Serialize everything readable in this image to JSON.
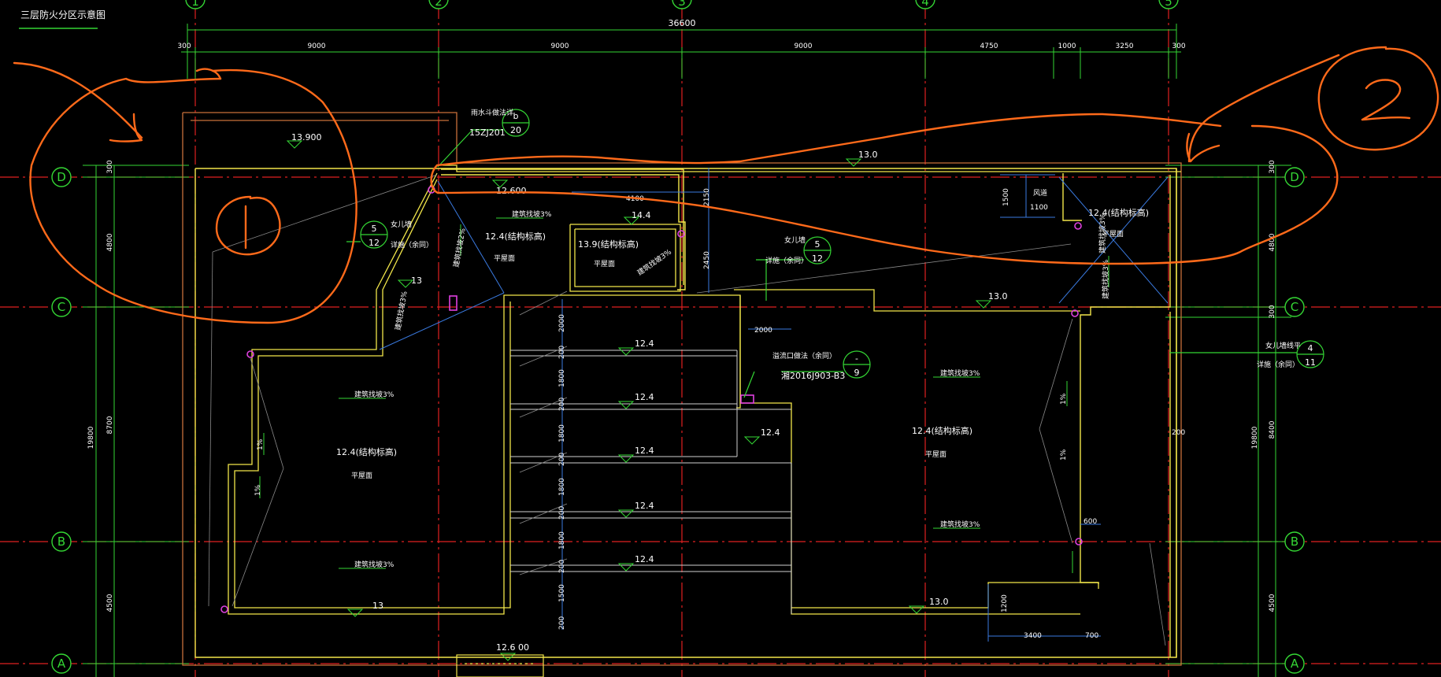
{
  "drawing_title": "三层防火分区示意图",
  "colors": {
    "background": "#000000",
    "grid_axis": "#e02020",
    "dimension": "#34d634",
    "wall": "#f2e64a",
    "parapet": "#e8853a",
    "slope": "#34d634",
    "annotation": "#ff6a1a",
    "pipe": "#e040e0",
    "thin": "#b0b0b0",
    "blue": "#3a7ae0"
  },
  "grid_columns": [
    "1",
    "2",
    "3",
    "4",
    "5"
  ],
  "grid_rows": [
    "D",
    "C",
    "B",
    "A"
  ],
  "overall_width": "36600",
  "column_spacings": [
    "300",
    "9000",
    "9000",
    "9000",
    "4750",
    "1000",
    "3250",
    "300"
  ],
  "left_row_dims": [
    "300",
    "4800",
    "8700",
    "4500"
  ],
  "left_total": "19800",
  "right_row_dims": [
    "300",
    "4800",
    "300",
    "8400",
    "4500"
  ],
  "right_total": "19800",
  "elevations": [
    "13.900",
    "12.600",
    "14.4",
    "13.0",
    "13.0",
    "13",
    "13",
    "13.0",
    "12.4",
    "12.4",
    "12.4",
    "12.4",
    "12.4",
    "12.4",
    "12.6 00"
  ],
  "roof_labels": {
    "structural_left_a": "12.4(结构标高)",
    "structural_left_b": "12.4(结构标高)",
    "structural_mid": "13.9(结构标高)",
    "structural_right_a": "12.4(结构标高)",
    "structural_right_b": "12.4(结构标高)",
    "roof_plane": "平屋面"
  },
  "slope_labels": {
    "two_pct": "建筑找坡2%",
    "three_pct": "建筑找坡3%",
    "one_pct": "1%"
  },
  "details": {
    "rain_outlet": "雨水斗做法详",
    "rain_outlet_atlas": "15ZJ201",
    "rain_outlet_ref_top": "b",
    "rain_outlet_ref_bottom": "20",
    "parapet": "女儿墙",
    "parapet_detail": "详施（余同）",
    "parapet_ref_top": "5",
    "parapet_ref_bottom": "12",
    "parapet_ref2_top": "4",
    "parapet_ref2_bottom": "11",
    "parapet_line": "女儿墙线平",
    "overflow": "溢流口做法（余同）",
    "overflow_atlas": "湘2016J903-B3",
    "overflow_ref_top": "-",
    "overflow_ref_bottom": "9",
    "shaft": "风道"
  },
  "inner_dims": {
    "d_4100": "4100",
    "d_2150": "2150",
    "d_2450": "2450",
    "d_1500": "1500",
    "d_1100": "1100",
    "d_2000": "2000",
    "d_stair_2000": "2000",
    "d_200": "200",
    "d_1800": "1800",
    "d_1500b": "1500",
    "d_200r": "200",
    "d_600": "600",
    "d_1200": "1200",
    "d_3400": "3400",
    "d_700": "700"
  },
  "annotations": {
    "circle_one": "1",
    "circle_two": "2"
  }
}
